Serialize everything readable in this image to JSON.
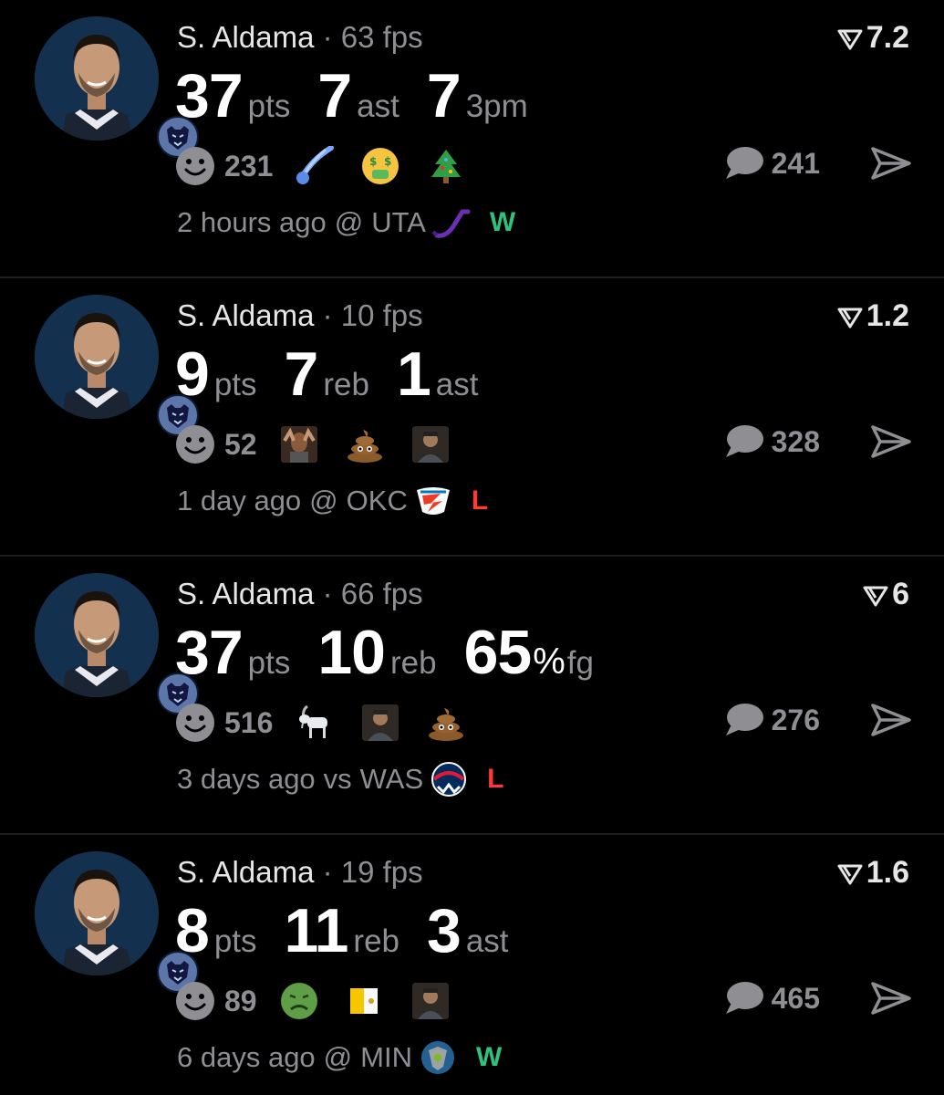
{
  "feed": {
    "cards": [
      {
        "player": "S. Aldama",
        "separator": "·",
        "fps": "63 fps",
        "score": "7.2",
        "stats": [
          {
            "num": "37",
            "pct": "",
            "unit": "pts"
          },
          {
            "num": "7",
            "pct": "",
            "unit": "ast"
          },
          {
            "num": "7",
            "pct": "",
            "unit": "3pm"
          }
        ],
        "reaction_count": "231",
        "emojis": [
          "comet-emoji",
          "money-face-emoji",
          "christmas-tree-emoji"
        ],
        "comment_count": "241",
        "time": "2 hours ago",
        "venue": "@",
        "opponent": "UTA",
        "opponent_logo": "jazz-logo",
        "result": "W"
      },
      {
        "player": "S. Aldama",
        "separator": "·",
        "fps": "10 fps",
        "score": "1.2",
        "stats": [
          {
            "num": "9",
            "pct": "",
            "unit": "pts"
          },
          {
            "num": "7",
            "pct": "",
            "unit": "reb"
          },
          {
            "num": "1",
            "pct": "",
            "unit": "ast"
          }
        ],
        "reaction_count": "52",
        "emojis": [
          "person-reaction-emoji",
          "poop-emoji",
          "person-photo-emoji"
        ],
        "comment_count": "328",
        "time": "1 day ago",
        "venue": "@",
        "opponent": "OKC",
        "opponent_logo": "thunder-logo",
        "result": "L"
      },
      {
        "player": "S. Aldama",
        "separator": "·",
        "fps": "66 fps",
        "score": "6",
        "stats": [
          {
            "num": "37",
            "pct": "",
            "unit": "pts"
          },
          {
            "num": "10",
            "pct": "",
            "unit": "reb"
          },
          {
            "num": "65",
            "pct": "%",
            "unit": "fg"
          }
        ],
        "reaction_count": "516",
        "emojis": [
          "goat-emoji",
          "person-photo-emoji",
          "poop-emoji"
        ],
        "comment_count": "276",
        "time": "3 days ago",
        "venue": "vs",
        "opponent": "WAS",
        "opponent_logo": "wizards-logo",
        "result": "L"
      },
      {
        "player": "S. Aldama",
        "separator": "·",
        "fps": "19 fps",
        "score": "1.6",
        "stats": [
          {
            "num": "8",
            "pct": "",
            "unit": "pts"
          },
          {
            "num": "11",
            "pct": "",
            "unit": "reb"
          },
          {
            "num": "3",
            "pct": "",
            "unit": "ast"
          }
        ],
        "reaction_count": "89",
        "emojis": [
          "nauseated-face-emoji",
          "vatican-flag-emoji",
          "person-photo-emoji"
        ],
        "comment_count": "465",
        "time": "6 days ago",
        "venue": "@",
        "opponent": "MIN",
        "opponent_logo": "timberwolves-logo",
        "result": "W"
      }
    ]
  },
  "colors": {
    "background": "#000000",
    "muted": "#8e8e93",
    "win": "#2ec27e",
    "loss": "#ff3b30",
    "divider": "#1e1e1e"
  },
  "icons": {
    "reaction": "smiley-icon",
    "comment": "speech-bubble-icon",
    "share": "send-arrow-icon",
    "score": "score-arrow-icon",
    "team_badge": "grizzlies-badge-icon"
  }
}
